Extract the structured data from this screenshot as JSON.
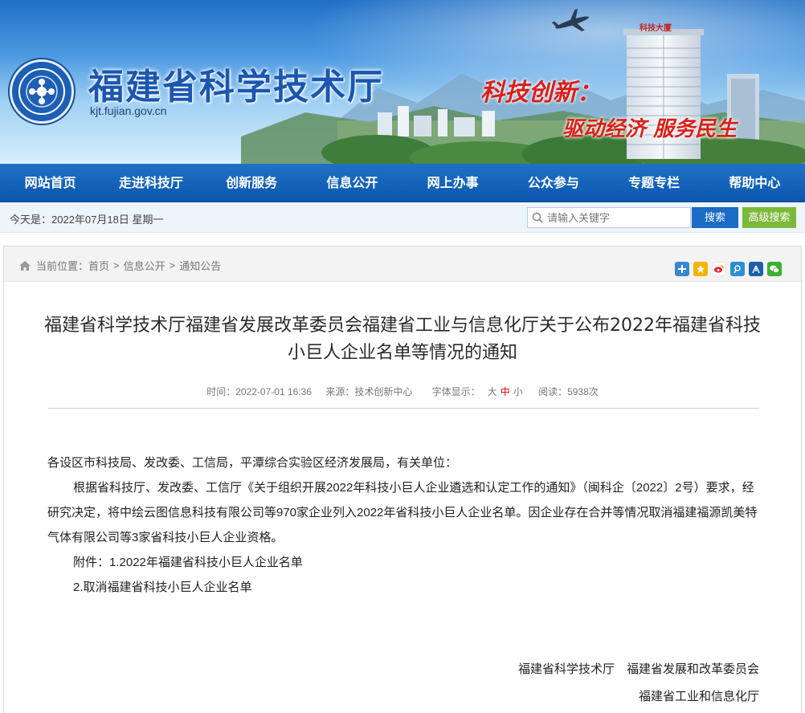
{
  "site": {
    "title": "福建省科学技术厅",
    "domain": "kjt.fujian.gov.cn",
    "slogan_line1": "科技创新：",
    "slogan_line2": "驱动经济 服务民生",
    "building_sign": "科技大厦"
  },
  "nav": {
    "items": [
      {
        "label": "网站首页"
      },
      {
        "label": "走进科技厅"
      },
      {
        "label": "创新服务"
      },
      {
        "label": "信息公开"
      },
      {
        "label": "网上办事"
      },
      {
        "label": "公众参与"
      },
      {
        "label": "专题专栏"
      },
      {
        "label": "帮助中心"
      }
    ]
  },
  "infobar": {
    "today": "今天是：2022年07月18日  星期一",
    "search_placeholder": "请输入关键字",
    "search_button": "搜索",
    "advanced_button": "高级搜索"
  },
  "breadcrumb": {
    "prefix": "当前位置：",
    "items": [
      "首页",
      "信息公开",
      "通知公告"
    ],
    "separator": ">"
  },
  "share_icons": [
    "plus-share-icon",
    "qzone-icon",
    "weibo-icon",
    "tencent-weibo-icon",
    "renren-icon",
    "wechat-icon"
  ],
  "article": {
    "title": "福建省科学技术厅福建省发展改革委员会福建省工业与信息化厅关于公布2022年福建省科技小巨人企业名单等情况的通知",
    "time": "时间：2022-07-01 16:36",
    "source": "来源：技术创新中心",
    "font_label": "字体显示：",
    "font_large": "大",
    "font_medium": "中",
    "font_small": "小",
    "views": "阅读：5938次",
    "salutation": "各设区市科技局、发改委、工信局，平潭综合实验区经济发展局，有关单位：",
    "paragraph": "根据省科技厅、发改委、工信厅《关于组织开展2022年科技小巨人企业遴选和认定工作的通知》（闽科企〔2022〕2号）要求，经研究决定，将中绘云图信息科技有限公司等970家企业列入2022年省科技小巨人企业名单。因企业存在合并等情况取消福建福源凯美特气体有限公司等3家省科技小巨人企业资格。",
    "attachment1": "附件：1.2022年福建省科技小巨人企业名单",
    "attachment2": "2.取消福建省科技小巨人企业名单",
    "signer1": "福建省科学技术厅　福建省发展和改革委员会",
    "signer2": "福建省工业和信息化厅"
  },
  "colors": {
    "nav_bg": "#0b57ad",
    "title_blue": "#1b57b0",
    "slogan_red": "#d8201a",
    "search_button": "#1a6cc4",
    "advanced_button": "#7cb93a"
  }
}
